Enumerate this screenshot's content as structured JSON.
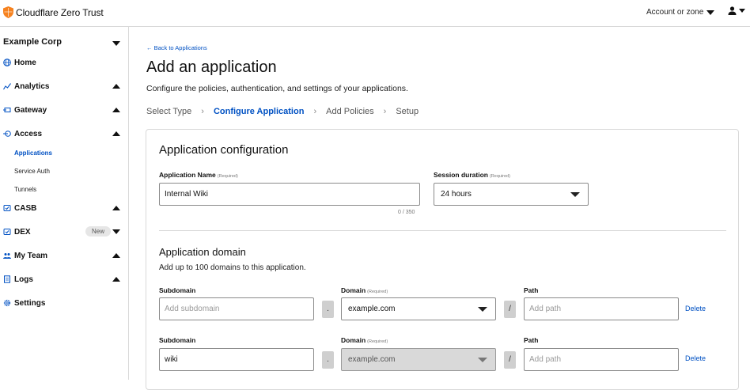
{
  "brand": {
    "name": "Cloudflare Zero Trust",
    "accent": "#f6821f",
    "link_color": "#0051c3"
  },
  "header": {
    "account_label": "Account or zone",
    "user_icon": "user-icon"
  },
  "sidebar": {
    "org": "Example Corp",
    "items": [
      {
        "label": "Home",
        "icon": "globe-icon"
      },
      {
        "label": "Analytics",
        "icon": "analytics-icon"
      },
      {
        "label": "Gateway",
        "icon": "gateway-icon"
      },
      {
        "label": "Access",
        "icon": "access-icon"
      },
      {
        "label": "CASB",
        "icon": "casb-icon"
      },
      {
        "label": "DEX",
        "icon": "dex-icon",
        "badge": "New"
      },
      {
        "label": "My Team",
        "icon": "team-icon"
      },
      {
        "label": "Logs",
        "icon": "logs-icon"
      },
      {
        "label": "Settings",
        "icon": "gear-icon"
      }
    ],
    "access_sub": [
      "Applications",
      "Service Auth",
      "Tunnels"
    ]
  },
  "main": {
    "back_link": "← Back to Applications",
    "title": "Add an application",
    "description": "Configure the policies, authentication, and settings of your applications.",
    "steps": [
      "Select Type",
      "Configure Application",
      "Add Policies",
      "Setup"
    ]
  },
  "config": {
    "title": "Application configuration",
    "app_name_label": "Application Name",
    "required": "(Required)",
    "app_name_value": "Internal Wiki",
    "counter": "0 / 350",
    "session_label": "Session duration",
    "session_value": "24 hours"
  },
  "domain": {
    "title": "Application domain",
    "subtitle": "Add up to 100 domains to this application.",
    "subdomain_label": "Subdomain",
    "domain_label": "Domain",
    "path_label": "Path",
    "dot": ".",
    "slash": "/",
    "delete_label": "Delete",
    "rows": [
      {
        "subdomain_placeholder": "Add subdomain",
        "subdomain_value": "",
        "domain": "example.com",
        "path_placeholder": "Add path"
      },
      {
        "subdomain_placeholder": "",
        "subdomain_value": "wiki",
        "domain": "example.com",
        "path_placeholder": "Add path"
      }
    ]
  }
}
